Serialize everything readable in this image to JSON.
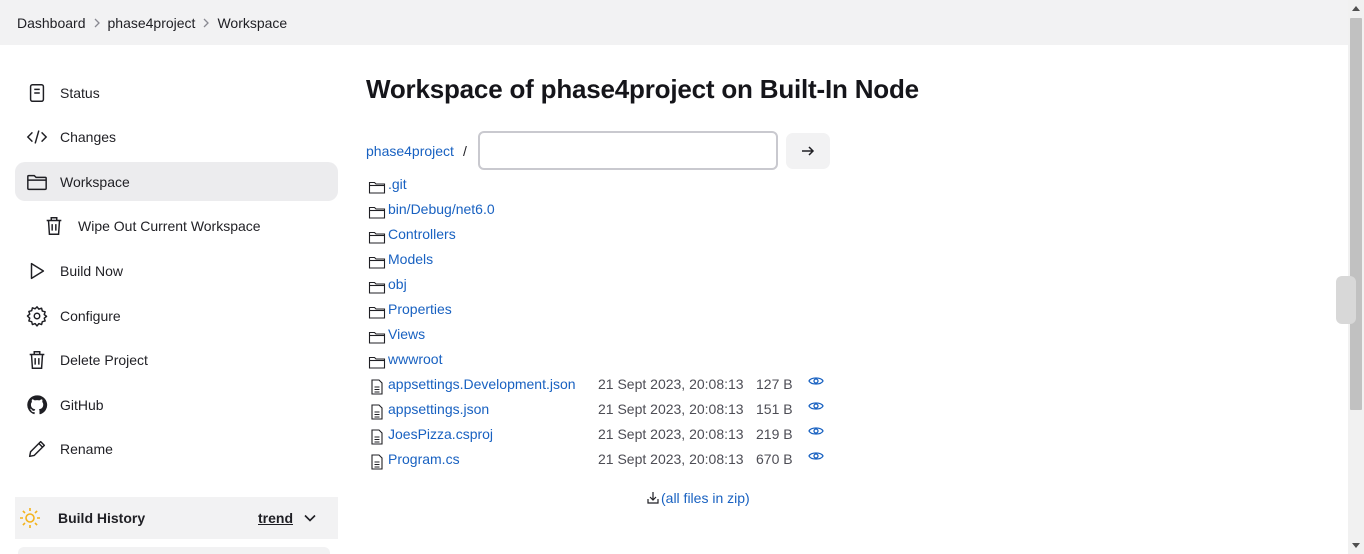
{
  "breadcrumb": [
    "Dashboard",
    "phase4project",
    "Workspace"
  ],
  "sidebar": {
    "items": [
      {
        "label": "Status",
        "icon": "status-icon"
      },
      {
        "label": "Changes",
        "icon": "code-icon"
      },
      {
        "label": "Workspace",
        "icon": "folder-icon",
        "active": true
      },
      {
        "label": "Wipe Out Current Workspace",
        "icon": "trash-icon",
        "sub": true
      },
      {
        "label": "Build Now",
        "icon": "play-icon"
      },
      {
        "label": "Configure",
        "icon": "gear-icon"
      },
      {
        "label": "Delete Project",
        "icon": "trash-icon"
      },
      {
        "label": "GitHub",
        "icon": "github-icon"
      },
      {
        "label": "Rename",
        "icon": "pencil-icon"
      }
    ],
    "build_history": {
      "title": "Build History",
      "trend": "trend"
    }
  },
  "main": {
    "title": "Workspace of phase4project on Built-In Node",
    "path_root": "phase4project",
    "path_sep": "/",
    "path_input_value": "",
    "entries": [
      {
        "name": ".git",
        "type": "folder"
      },
      {
        "name": "bin/Debug/net6.0",
        "type": "folder"
      },
      {
        "name": "Controllers",
        "type": "folder"
      },
      {
        "name": "Models",
        "type": "folder"
      },
      {
        "name": "obj",
        "type": "folder"
      },
      {
        "name": "Properties",
        "type": "folder"
      },
      {
        "name": "Views",
        "type": "folder"
      },
      {
        "name": "wwwroot",
        "type": "folder"
      },
      {
        "name": "appsettings.Development.json",
        "type": "file",
        "date": "21 Sept 2023, 20:08:13",
        "size": "127 B"
      },
      {
        "name": "appsettings.json",
        "type": "file",
        "date": "21 Sept 2023, 20:08:13",
        "size": "151 B"
      },
      {
        "name": "JoesPizza.csproj",
        "type": "file",
        "date": "21 Sept 2023, 20:08:13",
        "size": "219 B"
      },
      {
        "name": "Program.cs",
        "type": "file",
        "date": "21 Sept 2023, 20:08:13",
        "size": "670 B"
      }
    ],
    "zip_link": "(all files in zip)"
  },
  "colors": {
    "link": "#1861c1",
    "active_bg": "#ececee",
    "bar_bg": "#f2f2f3",
    "sun": "#f3b21b"
  }
}
